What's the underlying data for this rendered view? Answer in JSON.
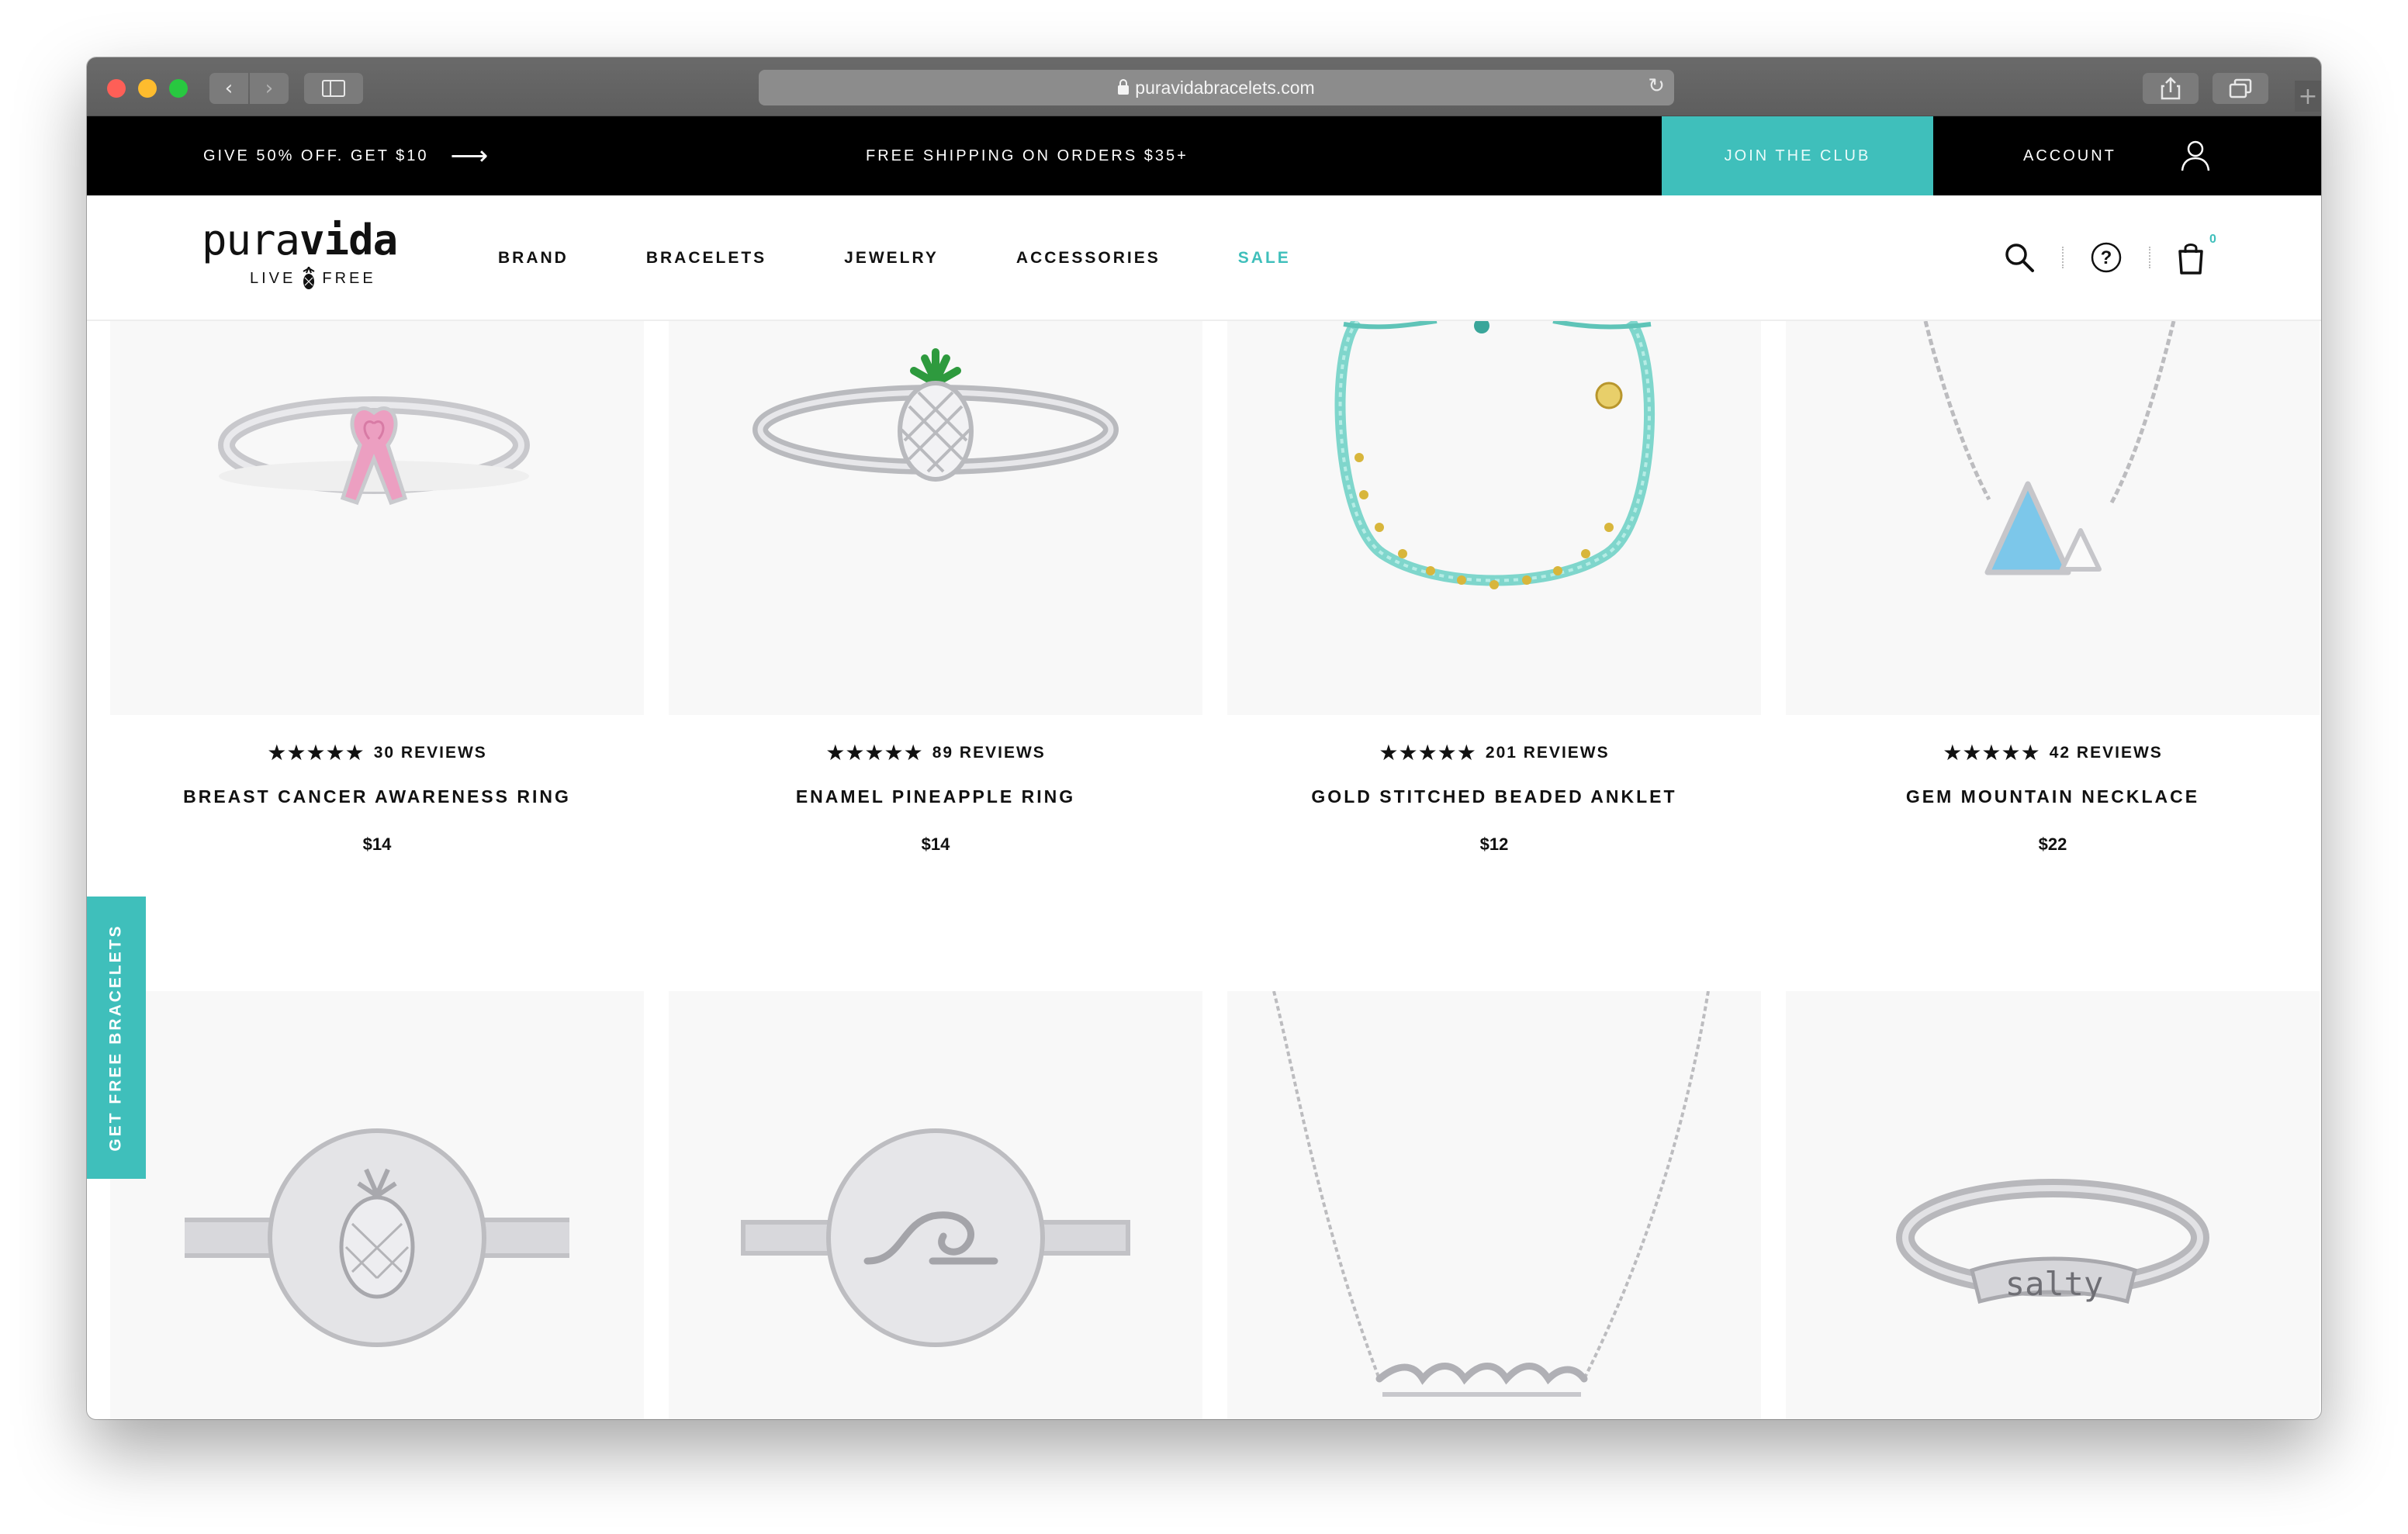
{
  "browser": {
    "url": "puravidabracelets.com"
  },
  "promo": {
    "left_text": "GIVE 50% OFF. GET $10",
    "center_text": "FREE SHIPPING ON ORDERS $35+",
    "join_label": "JOIN THE CLUB",
    "account_label": "ACCOUNT"
  },
  "logo": {
    "main_light": "pura",
    "main_bold": "vida",
    "tag_left": "LIVE",
    "tag_right": "FREE"
  },
  "nav": {
    "links": [
      "BRAND",
      "BRACELETS",
      "JEWELRY",
      "ACCESSORIES",
      "SALE"
    ],
    "cart_count": "0"
  },
  "side_tab": "GET FREE BRACELETS",
  "products": [
    {
      "name": "BREAST CANCER AWARENESS RING",
      "reviews": "30 REVIEWS",
      "price": "$14",
      "stars": "★★★★★",
      "image": "pink-ribbon-ring"
    },
    {
      "name": "ENAMEL PINEAPPLE RING",
      "reviews": "89 REVIEWS",
      "price": "$14",
      "stars": "★★★★★",
      "image": "pineapple-ring"
    },
    {
      "name": "GOLD STITCHED BEADED ANKLET",
      "reviews": "201 REVIEWS",
      "price": "$12",
      "stars": "★★★★★",
      "image": "beaded-anklet"
    },
    {
      "name": "GEM MOUNTAIN NECKLACE",
      "reviews": "42 REVIEWS",
      "price": "$22",
      "stars": "★★★★★",
      "image": "mountain-necklace"
    },
    {
      "image": "pineapple-signet-ring"
    },
    {
      "image": "wave-signet-ring"
    },
    {
      "image": "wave-necklace"
    },
    {
      "image": "salty-ring",
      "engraving": "salty"
    }
  ],
  "colors": {
    "accent": "#3fbfbb",
    "promo_bg": "#000000",
    "card_bg": "#f8f8f8",
    "pink": "#ec9fc1",
    "turquoise": "#7fd6cc",
    "gem_blue": "#7cc7ea"
  }
}
